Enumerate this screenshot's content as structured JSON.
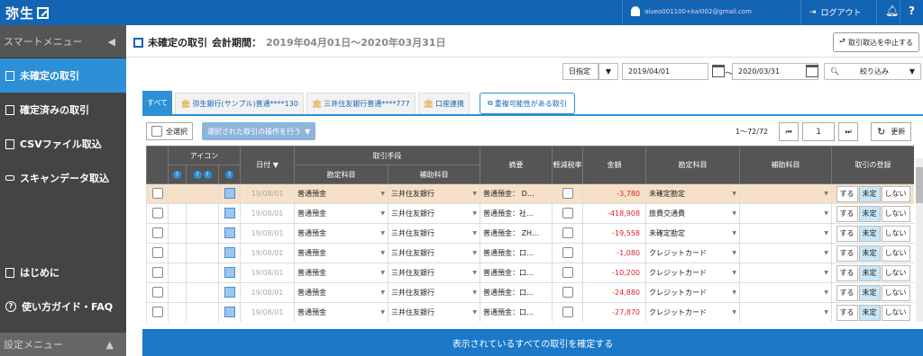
{
  "topbar": {
    "logo": "弥生",
    "email": "aiueo001100+kai002@gmail.com",
    "logout": "ログアウト",
    "bell": "bell-icon",
    "help": "?"
  },
  "sidebar": {
    "header": "スマートメニュー",
    "items": [
      {
        "label": "未確定の取引"
      },
      {
        "label": "確定済みの取引"
      },
      {
        "label": "CSVファイル取込"
      },
      {
        "label": "スキャンデータ取込"
      }
    ],
    "intro": "はじめに",
    "guide": "使い方ガイド・FAQ",
    "settings": "設定メニュー"
  },
  "header": {
    "title": "未確定の取引",
    "period_label": "会計期間：",
    "period": "2019年04月01日〜2020年03月31日",
    "stop_button": "取引取込を中止する"
  },
  "filter": {
    "mode": "日指定",
    "from": "2019/04/01",
    "sep": "〜",
    "to": "2020/03/31",
    "narrow": "絞り込み"
  },
  "tabs": [
    {
      "label": "すべて"
    },
    {
      "label": "弥生銀行(サンプル)普通****130"
    },
    {
      "label": "三井住友銀行普通****777"
    },
    {
      "label": "口座連携"
    }
  ],
  "dup_button": "重複可能性がある取引",
  "select_all": "全選択",
  "bulk_action": "選択された取引の操作を行う",
  "pager": {
    "count": "1〜72/72",
    "page": "1",
    "refresh": "更新"
  },
  "table": {
    "headers": {
      "icon": "アイコン",
      "date": "日付 ▼",
      "means": "取引手段",
      "account": "勘定科目",
      "subaccount": "補助科目",
      "summary": "摘要",
      "tax": "軽減税率",
      "amount": "金額",
      "dest_account": "勘定科目",
      "dest_sub": "補助科目",
      "register": "取引の登録"
    },
    "rows": [
      {
        "date": "19/08/01",
        "account": "普通預金",
        "sub": "三井住友銀行",
        "summary": "普通預金： D…",
        "amount": "-3,780",
        "dest": "未確定勘定"
      },
      {
        "date": "19/08/01",
        "account": "普通預金",
        "sub": "三井住友銀行",
        "summary": "普通預金：社…",
        "amount": "-418,908",
        "dest": "旅費交通費"
      },
      {
        "date": "19/08/01",
        "account": "普通預金",
        "sub": "三井住友銀行",
        "summary": "普通預金： ZH…",
        "amount": "-19,558",
        "dest": "未確定勘定"
      },
      {
        "date": "19/08/01",
        "account": "普通預金",
        "sub": "三井住友銀行",
        "summary": "普通預金：口…",
        "amount": "-1,080",
        "dest": "クレジットカード"
      },
      {
        "date": "19/08/01",
        "account": "普通預金",
        "sub": "三井住友銀行",
        "summary": "普通預金：口…",
        "amount": "-10,200",
        "dest": "クレジットカード"
      },
      {
        "date": "19/08/01",
        "account": "普通預金",
        "sub": "三井住友銀行",
        "summary": "普通預金：口…",
        "amount": "-24,880",
        "dest": "クレジットカード"
      },
      {
        "date": "19/08/01",
        "account": "普通預金",
        "sub": "三井住友銀行",
        "summary": "普通預金：口…",
        "amount": "-27,870",
        "dest": "クレジットカード"
      }
    ],
    "reg": {
      "yes": "する",
      "pending": "未定",
      "no": "しない"
    }
  },
  "confirm_all": "表示されているすべての取引を確定する",
  "colors": {
    "brand": "#1464b4",
    "active": "#2d8fd6",
    "negative": "#e0202a",
    "highlight": "#f7e0c8"
  }
}
